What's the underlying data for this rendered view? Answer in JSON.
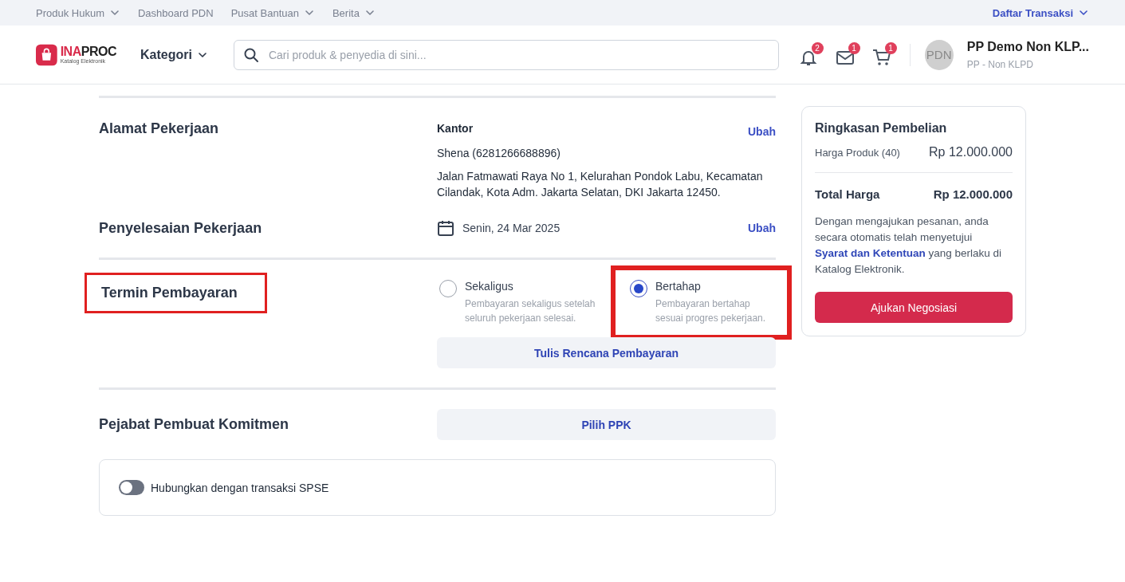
{
  "top_nav": {
    "links": [
      {
        "label": "Produk Hukum",
        "has_menu": true
      },
      {
        "label": "Dashboard PDN",
        "has_menu": false
      },
      {
        "label": "Pusat Bantuan",
        "has_menu": true
      },
      {
        "label": "Berita",
        "has_menu": true
      }
    ],
    "transactions": {
      "label": "Daftar Transaksi"
    }
  },
  "header": {
    "logo": {
      "name_prefix": "INA",
      "name_suffix": "PROC",
      "subtitle": "Katalog Elektronik"
    },
    "category_menu": "Kategori",
    "search": {
      "placeholder": "Cari produk & penyedia di sini..."
    },
    "notifications": [
      {
        "kind": "bell",
        "count": "2"
      },
      {
        "kind": "mail",
        "count": "1"
      },
      {
        "kind": "cart",
        "count": "1"
      }
    ],
    "user": {
      "avatar": "PDN",
      "name": "PP Demo Non KLP...",
      "role": "PP - Non KLPD"
    }
  },
  "address_section": {
    "title": "Alamat Pekerjaan",
    "label": "Kantor",
    "contact": "Shena (6281266688896)",
    "address": "Jalan Fatmawati Raya No 1, Kelurahan Pondok Labu, Kecamatan Cilandak, Kota Adm. Jakarta Selatan, DKI Jakarta 12450.",
    "action": "Ubah"
  },
  "completion_section": {
    "title": "Penyelesaian Pekerjaan",
    "date": "Senin, 24 Mar 2025",
    "action": "Ubah"
  },
  "payment_section": {
    "title": "Termin Pembayaran",
    "highlighted": true,
    "options": [
      {
        "label": "Sekaligus",
        "description": "Pembayaran sekaligus setelah seluruh pekerjaan selesai.",
        "selected": false,
        "highlighted": false
      },
      {
        "label": "Bertahap",
        "description": "Pembayaran bertahap sesuai progres pekerjaan.",
        "selected": true,
        "highlighted": true
      }
    ],
    "plan_button": "Tulis Rencana Pembayaran"
  },
  "ppk_section": {
    "title": "Pejabat Pembuat Komitmen",
    "button": "Pilih PPK"
  },
  "spse_toggle": {
    "label": "Hubungkan dengan transaksi SPSE",
    "on": false
  },
  "summary": {
    "title": "Ringkasan Pembelian",
    "lines": [
      {
        "label": "Harga Produk (40)",
        "value": "Rp 12.000.000"
      }
    ],
    "total": {
      "label": "Total Harga",
      "value": "Rp 12.000.000"
    },
    "terms": {
      "before": "Dengan mengajukan pesanan, anda secara otomatis telah menyetujui",
      "link": "Syarat dan Ketentuan",
      "after": "yang berlaku di Katalog Elektronik."
    },
    "submit_button": "Ajukan Negosiasi"
  }
}
